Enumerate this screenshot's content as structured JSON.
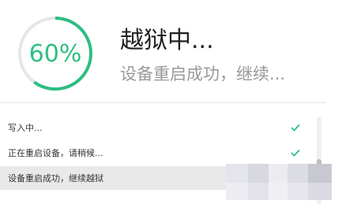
{
  "progress": {
    "percent": 60,
    "label": "60%",
    "color": "#2dbe82",
    "track_color": "#e6e6e6"
  },
  "header": {
    "title": "越狱中...",
    "subtitle": "设备重启成功，继续..."
  },
  "log": {
    "items": [
      {
        "text": "写入中...",
        "status": "done",
        "status_icon": "check-icon"
      },
      {
        "text": "正在重启设备，请稍候...",
        "status": "done",
        "status_icon": "check-icon"
      },
      {
        "text": "设备重启成功，继续越狱",
        "status": "in-progress",
        "status_icon": ""
      }
    ]
  },
  "colors": {
    "accent": "#2dbe82",
    "title": "#222222",
    "subtitle": "#999999",
    "active_row_bg": "#e9e9ea"
  }
}
